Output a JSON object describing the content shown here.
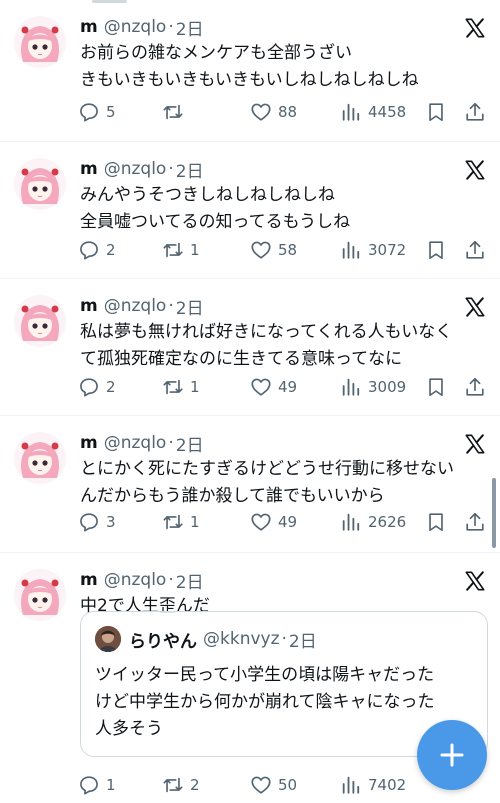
{
  "tweets": [
    {
      "name": "m",
      "handle": "@nzqlo",
      "dot": "·",
      "time": "2日",
      "lines": [
        "お前らの雑なメンケアも全部うざい",
        "きもいきもいきもいきもいしねしねしねしね"
      ],
      "replies": "5",
      "retweets": "",
      "likes": "88",
      "views": "4458"
    },
    {
      "name": "m",
      "handle": "@nzqlo",
      "dot": "·",
      "time": "2日",
      "lines": [
        "みんやうそつきしねしねしねしね",
        "全員嘘ついてるの知ってるもうしね"
      ],
      "replies": "2",
      "retweets": "1",
      "likes": "58",
      "views": "3072"
    },
    {
      "name": "m",
      "handle": "@nzqlo",
      "dot": "·",
      "time": "2日",
      "lines": [
        "私は夢も無ければ好きになってくれる人もいなく",
        "て孤独死確定なのに生きてる意味ってなに"
      ],
      "replies": "2",
      "retweets": "1",
      "likes": "49",
      "views": "3009"
    },
    {
      "name": "m",
      "handle": "@nzqlo",
      "dot": "·",
      "time": "2日",
      "lines": [
        "とにかく死にたすぎるけどどうせ行動に移せない",
        "んだからもう誰か殺して誰でもいいから"
      ],
      "replies": "3",
      "retweets": "1",
      "likes": "49",
      "views": "2626"
    },
    {
      "name": "m",
      "handle": "@nzqlo",
      "dot": "·",
      "time": "2日",
      "lines": [
        "中2で人生歪んだ"
      ],
      "replies": "1",
      "retweets": "2",
      "likes": "50",
      "views": "7402",
      "quote": {
        "name": "らりやん",
        "handle": "@kknvyz",
        "dot": "·",
        "time": "2日",
        "lines": [
          "ツイッター民って小学生の頃は陽キャだった",
          "けど中学生から何かが崩れて陰キャになった",
          "人多そう"
        ]
      }
    }
  ],
  "icons": {
    "reply": "reply-icon",
    "retweet": "retweet-icon",
    "like": "heart-icon",
    "views": "views-icon",
    "bookmark": "bookmark-icon",
    "share": "share-icon",
    "logo": "x-logo-icon",
    "compose": "plus-icon"
  },
  "colors": {
    "text": "#0f1419",
    "secondary": "#536471",
    "border": "#eff3f4",
    "fab": "#4a99e9"
  }
}
